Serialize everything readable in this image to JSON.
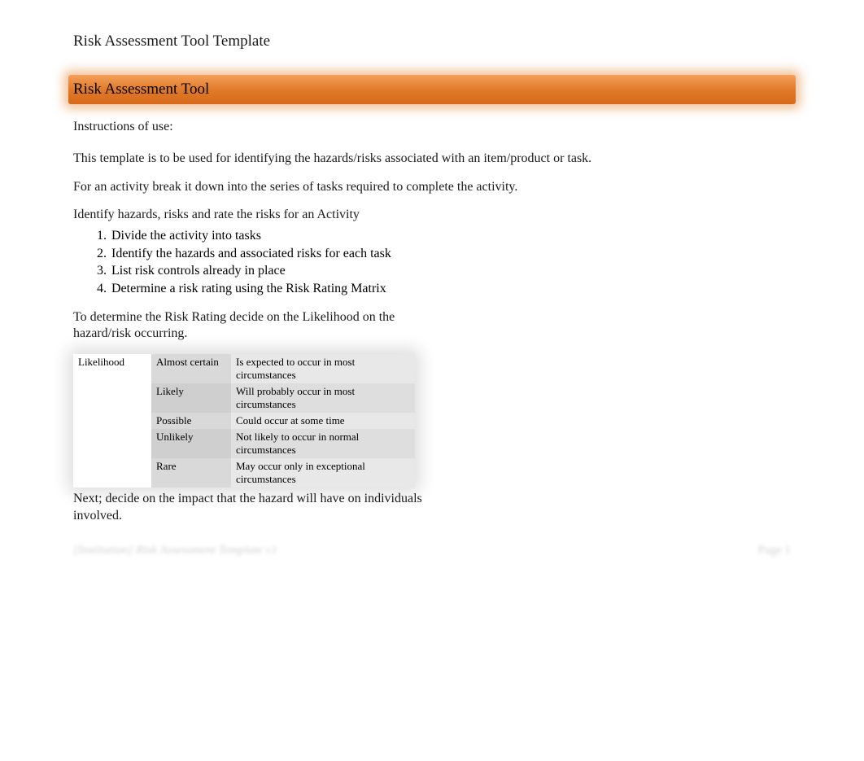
{
  "doc_title": "Risk Assessment Tool Template",
  "banner": "Risk Assessment Tool",
  "instructions_label": "Instructions of use:",
  "intro_1": "This template is to be used for identifying the hazards/risks associated with an item/product or task.",
  "intro_2": "For an activity break it down into the series of tasks required to complete the activity.",
  "identify_heading": "Identify hazards, risks and rate the risks for an Activity",
  "steps": [
    "Divide the activity into tasks",
    "Identify the hazards and associated risks for each task",
    "List risk controls already in place",
    "Determine a risk rating using the Risk Rating Matrix"
  ],
  "determine_text": "To determine the Risk Rating decide on the Likelihood on the hazard/risk occurring.",
  "likelihood": {
    "header": "Likelihood",
    "rows": [
      {
        "level": "Almost certain",
        "desc": "Is expected to occur in most circumstances"
      },
      {
        "level": "Likely",
        "desc": "Will probably occur in most circumstances"
      },
      {
        "level": "Possible",
        "desc": "Could occur at some time"
      },
      {
        "level": "Unlikely",
        "desc": "Not likely to occur in normal circumstances"
      },
      {
        "level": "Rare",
        "desc": "May occur only in exceptional circumstances"
      }
    ]
  },
  "next_text": "Next; decide on the impact that the hazard will have on individuals involved.",
  "footer_left": "[Institution] Risk Assessment Template v1",
  "footer_right": "Page 1"
}
